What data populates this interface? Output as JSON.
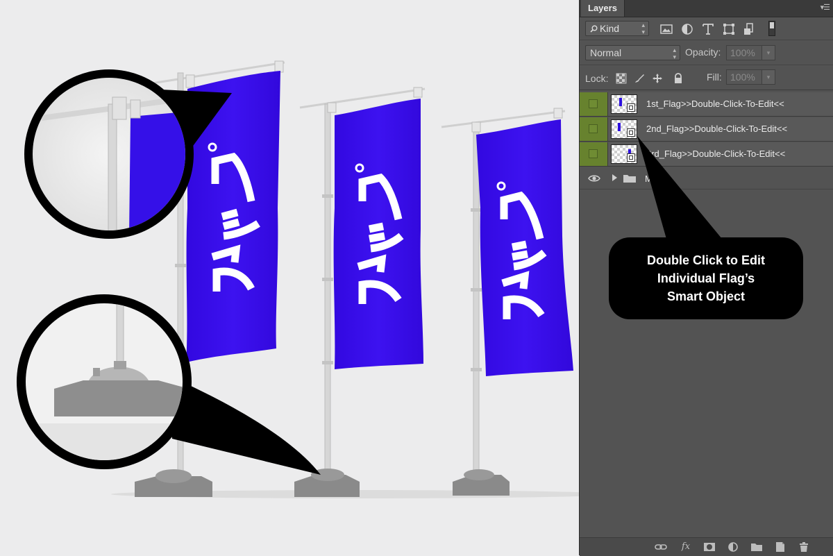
{
  "panel": {
    "tab_label": "Layers",
    "filter": {
      "kind_label": "Kind"
    },
    "blend": {
      "mode": "Normal",
      "opacity_label": "Opacity:",
      "opacity_value": "100%"
    },
    "lock": {
      "lock_label": "Lock:",
      "fill_label": "Fill:",
      "fill_value": "100%"
    },
    "layers": [
      {
        "name": "1st_Flag>>Double-Click-To-Edit<<"
      },
      {
        "name": "2nd_Flag>>Double-Click-To-Edit<<"
      },
      {
        "name": "3rd_Flag>>Double-Click-To-Edit<<"
      },
      {
        "name": "Ma"
      }
    ]
  },
  "callout": {
    "line1": "Double Click to Edit",
    "line2": "Individual Flag’s",
    "line3": "Smart Object"
  },
  "colors": {
    "flag": "#3a10e8",
    "layer_visibility": "#67822e",
    "panel_bg": "#535353"
  }
}
